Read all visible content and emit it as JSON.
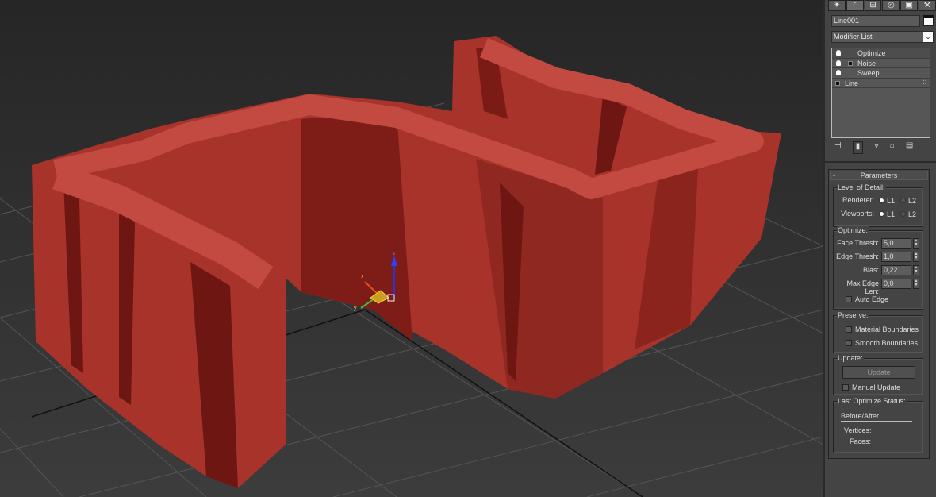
{
  "command_panel": {
    "tabs": [
      {
        "name": "create",
        "icon": "☀"
      },
      {
        "name": "modify",
        "icon": "◜"
      },
      {
        "name": "hierarchy",
        "icon": "⊞"
      },
      {
        "name": "motion",
        "icon": "◎"
      },
      {
        "name": "display",
        "icon": "▣"
      },
      {
        "name": "utilities",
        "icon": "⚒"
      }
    ],
    "object_name": "Line001",
    "object_color": "#ffffff",
    "modifier_list": "Modifier List",
    "stack": [
      {
        "label": "Optimize",
        "bulb": true,
        "plus": false
      },
      {
        "label": "Noise",
        "bulb": true,
        "plus": true
      },
      {
        "label": "Sweep",
        "bulb": true,
        "plus": false
      },
      {
        "label": "Line",
        "bulb": false,
        "plus": true
      }
    ]
  },
  "parameters": {
    "title": "Parameters",
    "collapse": "-",
    "level_of_detail": {
      "title": "Level of Detail:",
      "renderer_label": "Renderer:",
      "viewports_label": "Viewports:",
      "l1": "L1",
      "l2": "L2",
      "renderer_selected": "L1",
      "viewports_selected": "L1"
    },
    "optimize": {
      "title": "Optimize:",
      "face_thresh_label": "Face Thresh:",
      "face_thresh": "5,0",
      "edge_thresh_label": "Edge Thresh:",
      "edge_thresh": "1,0",
      "bias_label": "Bias:",
      "bias": "0,22",
      "max_edge_label": "Max Edge Len:",
      "max_edge": "0,0",
      "auto_edge": "Auto Edge"
    },
    "preserve": {
      "title": "Preserve:",
      "material": "Material Boundaries",
      "smooth": "Smooth Boundaries"
    },
    "update": {
      "title": "Update:",
      "button": "Update",
      "manual": "Manual Update"
    },
    "status": {
      "title": "Last Optimize Status:",
      "before_after": "Before/After",
      "vertices": "Vertices:",
      "faces": "Faces:"
    }
  },
  "gizmo": {
    "x": "x",
    "y": "y",
    "z": "z"
  },
  "colors": {
    "object": "#a8332b",
    "object_top": "#c24a40",
    "object_dark": "#6e1712"
  }
}
